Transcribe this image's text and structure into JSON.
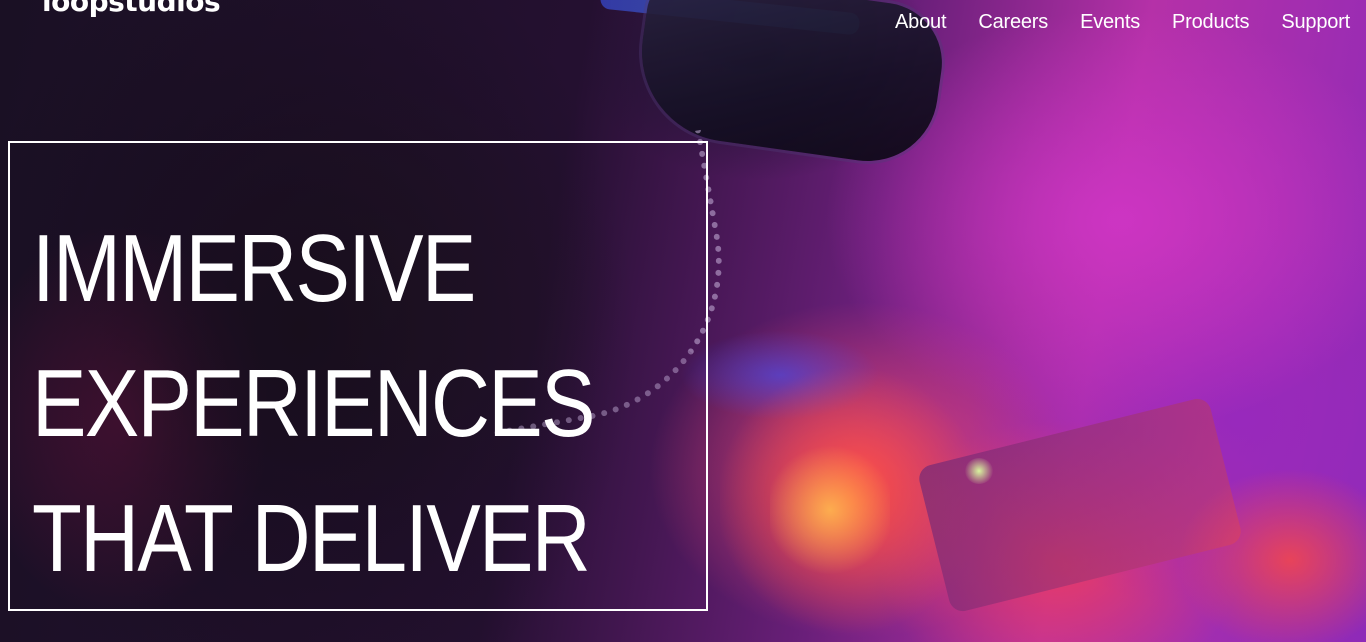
{
  "brand": {
    "logo_text": "loopstudios"
  },
  "nav": {
    "items": [
      {
        "label": "About"
      },
      {
        "label": "Careers"
      },
      {
        "label": "Events"
      },
      {
        "label": "Products"
      },
      {
        "label": "Support"
      }
    ]
  },
  "hero": {
    "headline_lines": [
      "IMMERSIVE",
      "EXPERIENCES",
      "THAT DELIVER"
    ]
  }
}
